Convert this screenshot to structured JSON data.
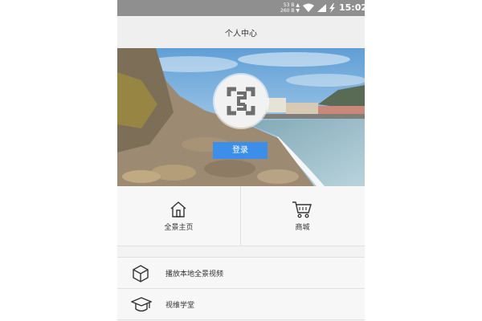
{
  "statusbar": {
    "speed_up": "53 B",
    "speed_down": "260 B",
    "time": "15:02"
  },
  "header": {
    "title": "个人中心"
  },
  "profile": {
    "avatar_icon": "user-logo-icon",
    "login_label": "登录",
    "login_color": "#3d8ee8"
  },
  "quick_actions": [
    {
      "label": "全景主页",
      "icon": "home-icon"
    },
    {
      "label": "商城",
      "icon": "cart-icon"
    }
  ],
  "menu": [
    {
      "label": "播放本地全景视频",
      "icon": "cube-icon"
    },
    {
      "label": "视维学堂",
      "icon": "graduation-cap-icon"
    }
  ]
}
